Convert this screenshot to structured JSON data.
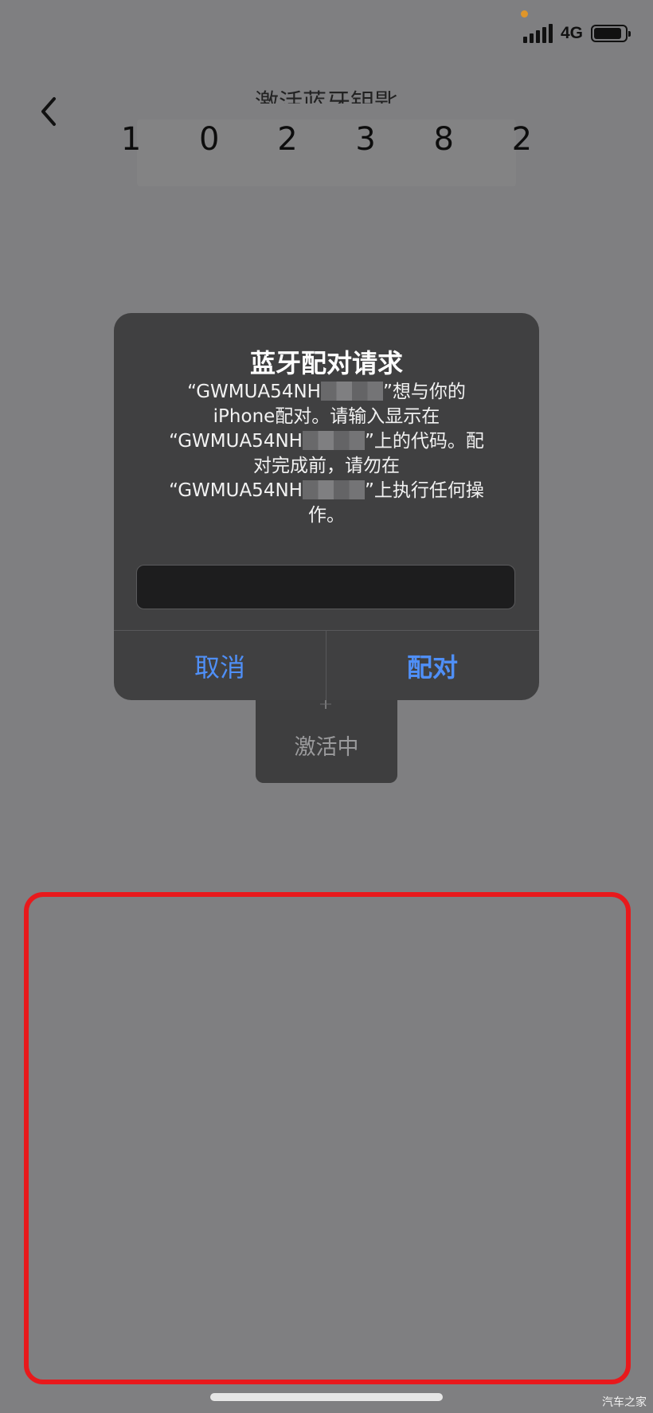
{
  "status_bar": {
    "network": "4G",
    "battery_level": 0.9,
    "signal_bars": 4
  },
  "header": {
    "title": "激活蓝牙钥匙",
    "code": "1 0 2 3 8 2"
  },
  "alert": {
    "title": "蓝牙配对请求",
    "message_lines": [
      [
        "“GWMUA54NH",
        "”想与你的"
      ],
      [
        "iPhone配对。请输入显示在"
      ],
      [
        "“GWMUA54NH",
        "”上的代码。配"
      ],
      [
        "对完成前，请勿在"
      ],
      [
        "“GWMUA54NH",
        "”上执行任何操"
      ],
      [
        "作。"
      ]
    ],
    "input_value": "",
    "input_placeholder": "",
    "cancel_label": "取消",
    "pair_label": "配对",
    "button_color": "#4f8ff7"
  },
  "toast": {
    "text": "激活中"
  },
  "highlight": {
    "color": "#e8191c"
  },
  "watermark": "汽车之家",
  "icons": {
    "back": "chevron-left-icon",
    "signal": "cellular-signal-icon",
    "battery": "battery-icon"
  }
}
